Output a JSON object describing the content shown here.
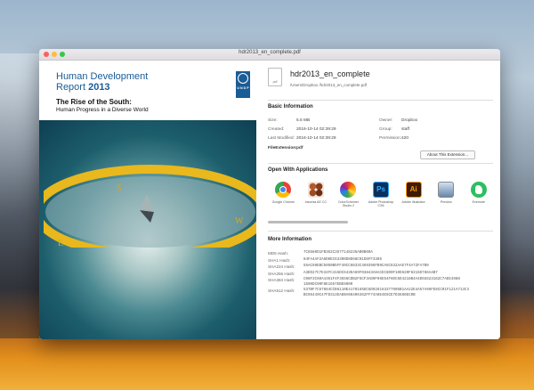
{
  "window": {
    "title": "hdr2013_en_complete.pdf"
  },
  "cover": {
    "title_line1": "Human Development",
    "title_line2a": "Report ",
    "title_line2b": "2013",
    "subtitle1": "The Rise of the South:",
    "subtitle2": "Human Progress in a Diverse World",
    "logo_text": "U N D P"
  },
  "file": {
    "name": "hdr2013_en_complete",
    "path": "/Users/Dropbox /hdr2013_en_complete.pdf",
    "icon_label": "pdf"
  },
  "basic": {
    "heading": "Basic Information",
    "size_k": "Size:",
    "size_v": "5.5 MB",
    "created_k": "Created:",
    "created_v": "2016-10-14 02:39:29",
    "modified_k": "Last Modified:",
    "modified_v": "2016-10-14 02:39:29",
    "ext_k": "FileExtension:",
    "ext_v": "pdf",
    "owner_k": "Owner:",
    "owner_v": "Dropbox",
    "group_k": "Group:",
    "group_v": "staff",
    "perm_k": "Permission:",
    "perm_v": "420",
    "about_button": "About This Extension..."
  },
  "open_with": {
    "heading": "Open With Applications",
    "apps": [
      {
        "label": "Google Chrome",
        "icon": "chrome-icon",
        "color": "#e94335"
      },
      {
        "label": "Insomia AE CC",
        "icon": "insomnia-icon",
        "color": "#5a2a16"
      },
      {
        "label": "ColorSchemer Studio 2",
        "icon": "colorschemer-icon",
        "color": "#d38a2b"
      },
      {
        "label": "Adobe Photoshop CS6",
        "icon": "photoshop-icon",
        "color": "#0a2f5a"
      },
      {
        "label": "Adobe Illustrator",
        "icon": "illustrator-icon",
        "color": "#3b1a06"
      },
      {
        "label": "Preview",
        "icon": "preview-icon",
        "color": "#6a86a8"
      },
      {
        "label": "Evernote",
        "icon": "evernote-icon",
        "color": "#2dbe60"
      }
    ]
  },
  "more": {
    "heading": "More Information",
    "rows": [
      {
        "k": "MD5 Hash:",
        "v": "7C6580D1FB362C3577148235AB0B60A"
      },
      {
        "k": "SHA1 Hash:",
        "v": "84FA4AF2A6D0EC63300D8D68C01D6FF3305"
      },
      {
        "k": "SHA224 Hash:",
        "v": "55AC98EBC5050B5FF40CC6833C469396FB9CA5C632AAE7F4A72FA7B9"
      },
      {
        "k": "SHA256 Hash:",
        "v": "A3ED27C7E34FC415DC643EA69F03843A6ACEC8D0F10D620F8215D786A4B7"
      },
      {
        "k": "SHA384 Hash:",
        "v": "C08F3C60A4351F4F3556CDB2F5CF3AD0F06E54F6DC6D4218B4A4D6G623162C7AEE4988",
        "v2": "1590DC09F8E1657EBE6000"
      },
      {
        "k": "SHA512 Hash:",
        "v": "537BF7C67884CCB6110E4170165DC6D928163377905B1AA22E4A57A95FE8CC01F121A713C3",
        "v2": "BC96449C47FD313EAEBA08406362FF74A8E4E5CE7D3686EC0B"
      }
    ]
  }
}
